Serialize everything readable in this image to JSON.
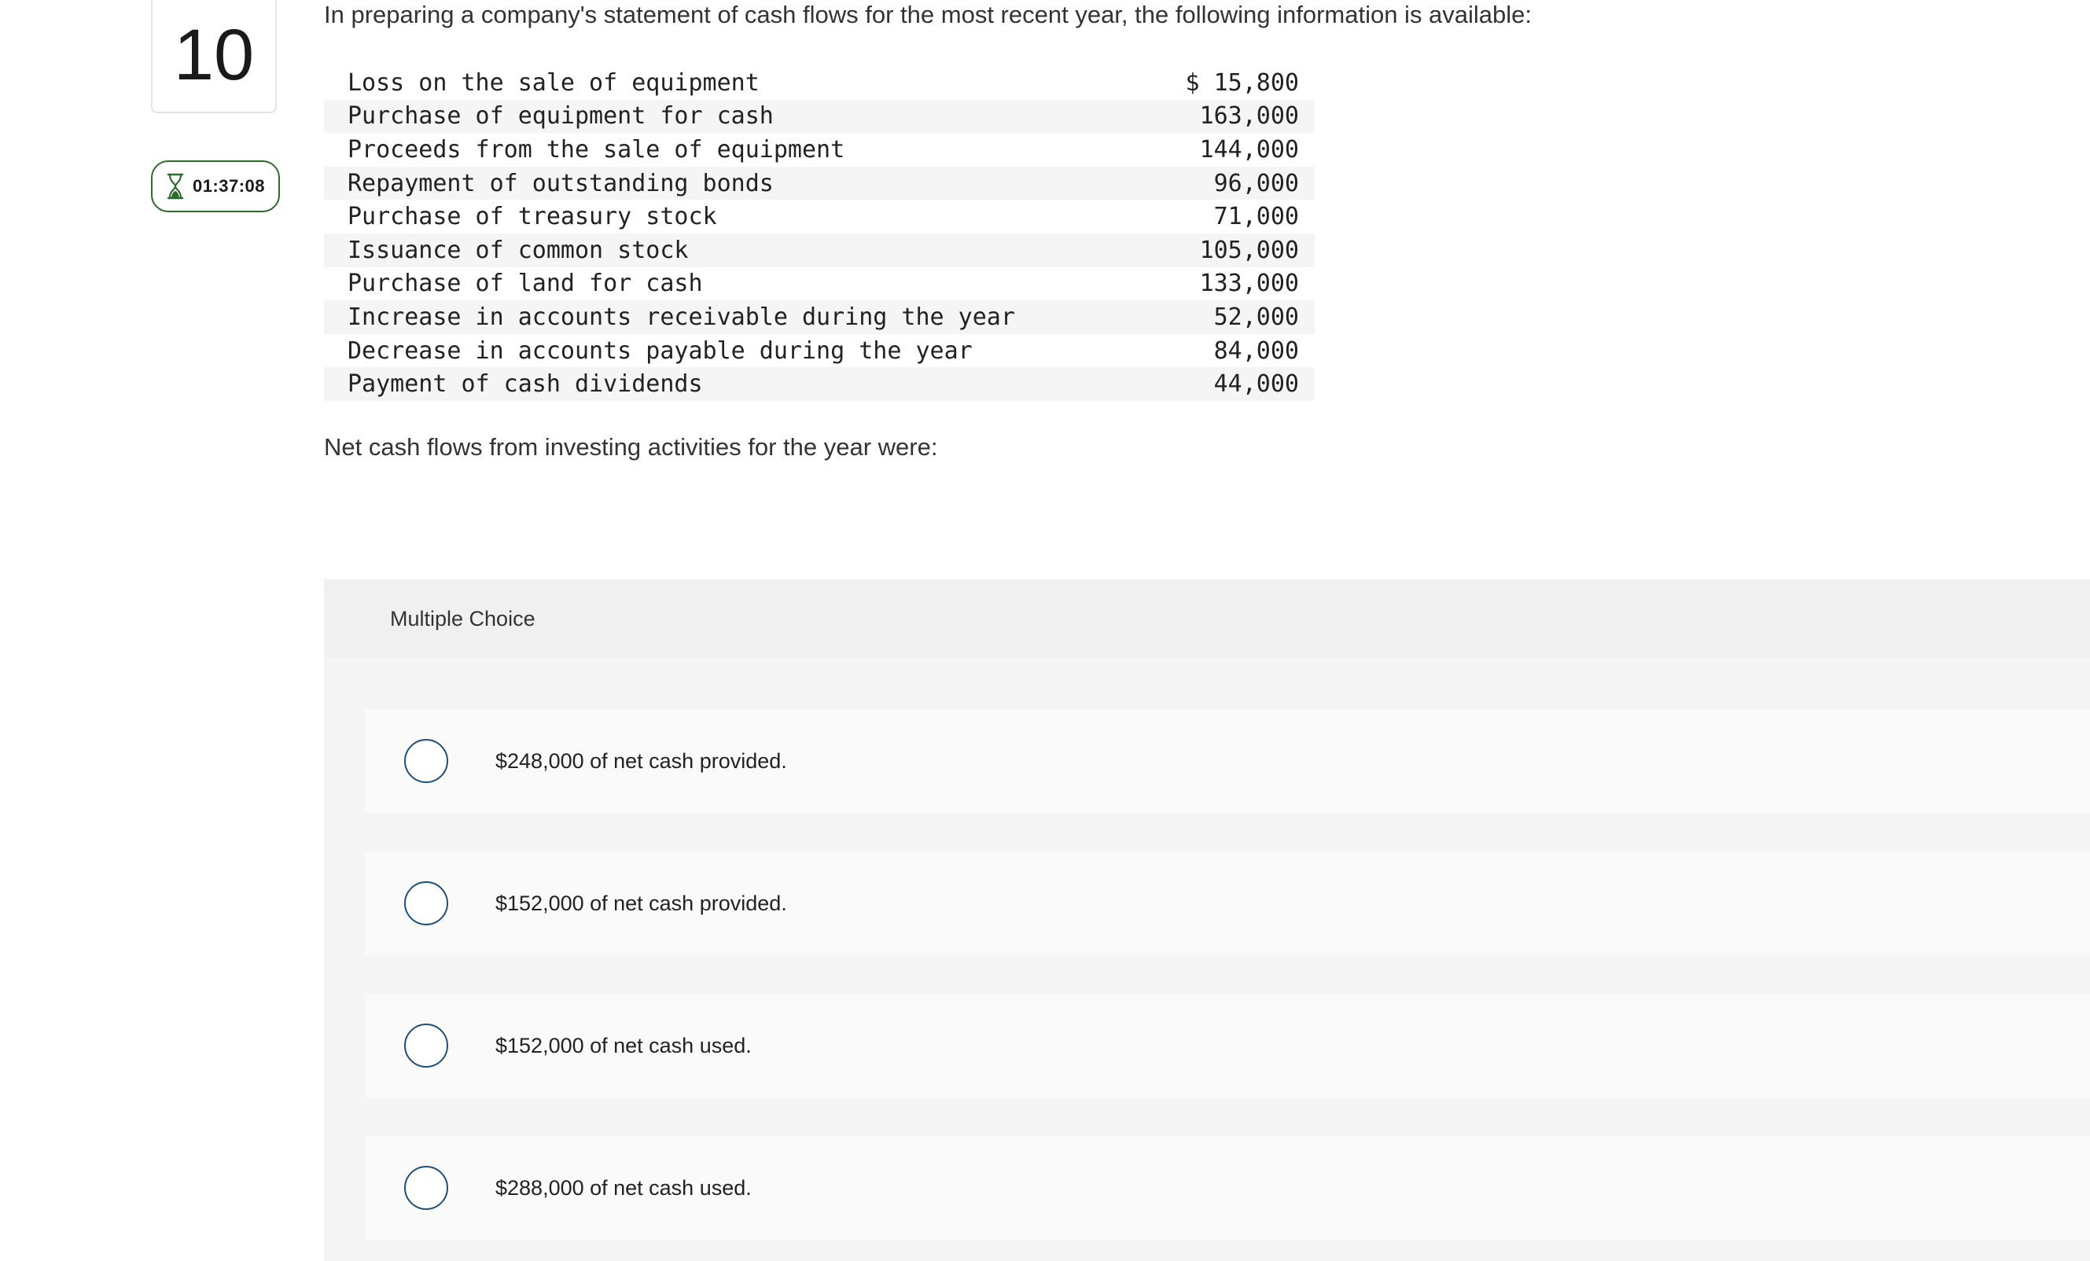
{
  "question": {
    "number": "10",
    "timer": "01:37:08",
    "intro": "In preparing a company's statement of cash flows for the most recent year, the following information is available:",
    "table": [
      {
        "label": "Loss on the sale of equipment",
        "amount": "$ 15,800"
      },
      {
        "label": "Purchase of equipment for cash",
        "amount": "163,000"
      },
      {
        "label": "Proceeds from the sale of equipment",
        "amount": "144,000"
      },
      {
        "label": "Repayment of outstanding bonds",
        "amount": "96,000"
      },
      {
        "label": "Purchase of treasury stock",
        "amount": "71,000"
      },
      {
        "label": "Issuance of common stock",
        "amount": "105,000"
      },
      {
        "label": "Purchase of land for cash",
        "amount": "133,000"
      },
      {
        "label": "Increase in accounts receivable during the year",
        "amount": "52,000"
      },
      {
        "label": "Decrease in accounts payable during the year",
        "amount": "84,000"
      },
      {
        "label": "Payment of cash dividends",
        "amount": "44,000"
      }
    ],
    "prompt": "Net cash flows from investing activities for the year were:"
  },
  "multiple_choice": {
    "header": "Multiple Choice",
    "options": [
      {
        "text": "$248,000 of net cash provided."
      },
      {
        "text": "$152,000 of net cash provided."
      },
      {
        "text": "$152,000 of net cash used."
      },
      {
        "text": "$288,000 of net cash used."
      }
    ]
  },
  "colors": {
    "timer_border": "#2e6b2e",
    "radio_border": "#1f4e79",
    "panel_bg": "#f5f5f5"
  },
  "icons": {
    "timer": "hourglass-icon"
  }
}
